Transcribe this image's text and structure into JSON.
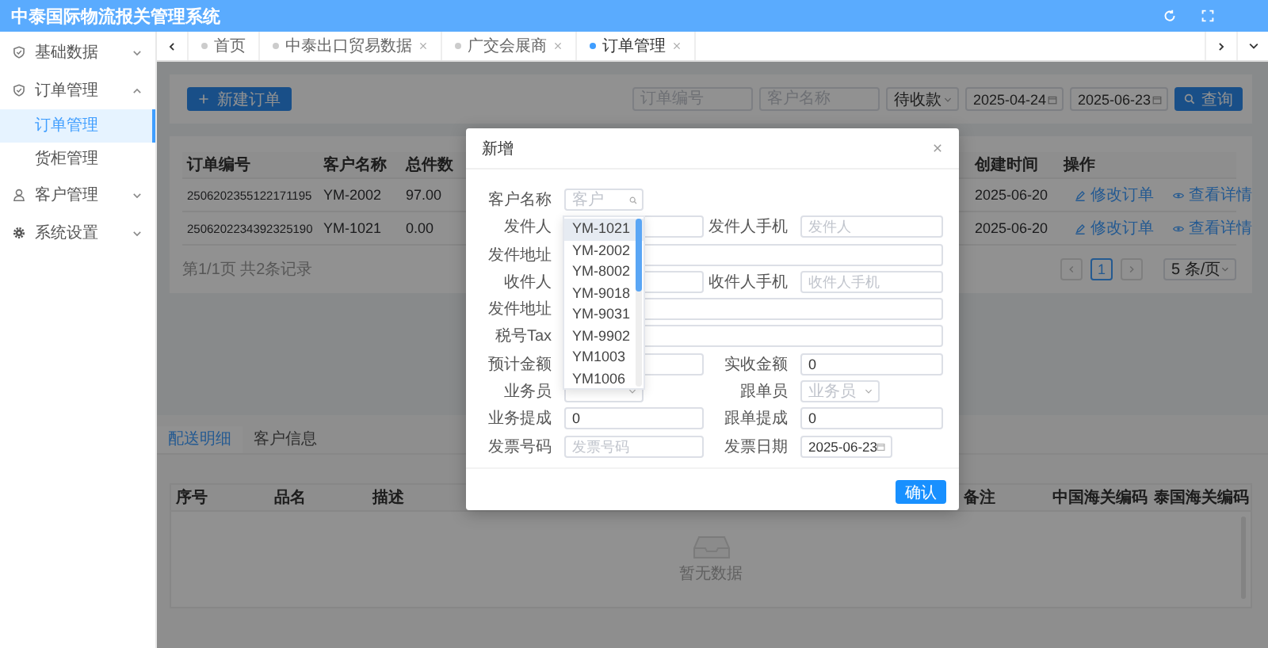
{
  "app": {
    "title": "中泰国际物流报关管理系统"
  },
  "sidebar": {
    "items": [
      {
        "label": "基础数据",
        "expanded": false
      },
      {
        "label": "订单管理",
        "expanded": true,
        "children": [
          {
            "label": "订单管理",
            "selected": true
          },
          {
            "label": "货柜管理",
            "selected": false
          }
        ]
      },
      {
        "label": "客户管理",
        "expanded": false
      },
      {
        "label": "系统设置",
        "expanded": false
      }
    ]
  },
  "tabs": [
    {
      "label": "首页",
      "selected": false,
      "closable": false
    },
    {
      "label": "中泰出口贸易数据",
      "selected": false,
      "closable": true
    },
    {
      "label": "广交会展商",
      "selected": false,
      "closable": true
    },
    {
      "label": "订单管理",
      "selected": true,
      "closable": true
    }
  ],
  "toolbar": {
    "new_button": "新建订单",
    "filters": [
      {
        "kind": "text",
        "placeholder": "订单编号"
      },
      {
        "kind": "text",
        "placeholder": "客户名称"
      },
      {
        "kind": "select",
        "value": "待收款"
      },
      {
        "kind": "date",
        "value": "2025-04-24"
      },
      {
        "kind": "date",
        "value": "2025-06-23"
      }
    ],
    "search_button": "查询"
  },
  "orders": {
    "columns": [
      "订单编号",
      "客户名称",
      "总件数",
      "创建时间",
      "操作"
    ],
    "rows": [
      {
        "cells": [
          "2506202355122171195",
          "YM-2002",
          "97.00",
          "2025-06-20"
        ],
        "actions": [
          "修改订单",
          "查看详情"
        ]
      },
      {
        "cells": [
          "2506202234392325190",
          "YM-1021",
          "0.00",
          "2025-06-20"
        ],
        "actions": [
          "修改订单",
          "查看详情"
        ]
      }
    ]
  },
  "pagination": {
    "summary": "第1/1页 共2条记录",
    "pages": [
      {
        "label": "1",
        "selected": true
      }
    ],
    "page_size": "5 条/页"
  },
  "detail_tabs": [
    {
      "label": "配送明细",
      "selected": true
    },
    {
      "label": "客户信息",
      "selected": false
    }
  ],
  "detail_table": {
    "columns_left": [
      "序号",
      "品名",
      "描述"
    ],
    "columns_right": [
      "备注",
      "中国海关编码",
      "泰国海关编码"
    ],
    "empty_text": "暂无数据"
  },
  "dialog": {
    "title": "新增",
    "rows": [
      {
        "fields": [
          {
            "label": "客户名称",
            "kind": "search",
            "placeholder": "客户"
          }
        ]
      },
      {
        "fields": [
          {
            "label": "发件人",
            "kind": "text"
          },
          {
            "label": "发件人手机",
            "kind": "text",
            "placeholder": "发件人"
          }
        ]
      },
      {
        "fields": [
          {
            "label": "发件地址",
            "kind": "text"
          }
        ]
      },
      {
        "fields": [
          {
            "label": "收件人",
            "kind": "text"
          },
          {
            "label": "收件人手机",
            "kind": "text",
            "placeholder": "收件人手机"
          }
        ]
      },
      {
        "fields": [
          {
            "label": "发件地址",
            "kind": "text"
          }
        ]
      },
      {
        "fields": [
          {
            "label": "税号Tax",
            "kind": "text"
          }
        ]
      },
      {
        "fields": [
          {
            "label": "预计金额",
            "kind": "text"
          },
          {
            "label": "实收金额",
            "kind": "text",
            "value": "0"
          }
        ]
      },
      {
        "fields": [
          {
            "label": "业务员",
            "kind": "select"
          },
          {
            "label": "跟单员",
            "kind": "select",
            "placeholder": "业务员"
          }
        ]
      },
      {
        "fields": [
          {
            "label": "业务提成",
            "kind": "text",
            "value": "0"
          },
          {
            "label": "跟单提成",
            "kind": "text",
            "value": "0"
          }
        ]
      },
      {
        "fields": [
          {
            "label": "发票号码",
            "kind": "text",
            "placeholder": "发票号码"
          },
          {
            "label": "发票日期",
            "kind": "date",
            "value": "2025-06-23"
          }
        ]
      }
    ],
    "confirm": "确认",
    "dropdown": {
      "options": [
        {
          "label": "YM-1021",
          "highlighted": true
        },
        {
          "label": "YM-2002",
          "highlighted": false
        },
        {
          "label": "YM-8002",
          "highlighted": false
        },
        {
          "label": "YM-9018",
          "highlighted": false
        },
        {
          "label": "YM-9031",
          "highlighted": false
        },
        {
          "label": "YM-9902",
          "highlighted": false
        },
        {
          "label": "YM1003",
          "highlighted": false
        },
        {
          "label": "YM1006",
          "highlighted": false
        }
      ]
    }
  }
}
